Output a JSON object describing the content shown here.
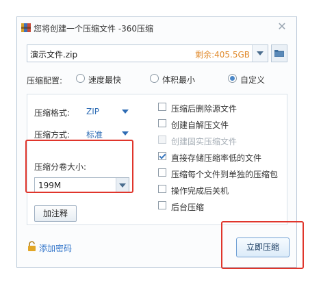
{
  "window": {
    "title": "您将创建一个压缩文件 -360压缩",
    "close_label": "✕"
  },
  "file": {
    "name": "演示文件.zip",
    "space_label": "剩余:405.5GB"
  },
  "config": {
    "label": "压缩配置:",
    "options": [
      "速度最快",
      "体积最小",
      "自定义"
    ],
    "selected": "自定义"
  },
  "format": {
    "label": "压缩格式:",
    "value": "ZIP"
  },
  "method": {
    "label": "压缩方式:",
    "value": "标准"
  },
  "volume": {
    "label": "压缩分卷大小:",
    "value": "199M"
  },
  "comment_button": "加注释",
  "checkboxes": [
    {
      "label": "压缩后删除源文件",
      "checked": false,
      "disabled": false
    },
    {
      "label": "创建自解压文件",
      "checked": false,
      "disabled": false
    },
    {
      "label": "创建固实压缩文件",
      "checked": false,
      "disabled": true
    },
    {
      "label": "直接存储压缩率低的文件",
      "checked": true,
      "disabled": false
    },
    {
      "label": "压缩每个文件到单独的压缩包",
      "checked": false,
      "disabled": false
    },
    {
      "label": "操作完成后关机",
      "checked": false,
      "disabled": false
    },
    {
      "label": "后台压缩",
      "checked": false,
      "disabled": false
    }
  ],
  "add_password": "添加密码",
  "start_button": "立即压缩",
  "icons": {
    "app": "archive-icon",
    "folder": "folder-icon",
    "lock": "lock-icon"
  },
  "colors": {
    "accent": "#2e6cb4",
    "space": "#e08a2c",
    "highlight": "#e0352b",
    "link": "#2f73c9"
  }
}
